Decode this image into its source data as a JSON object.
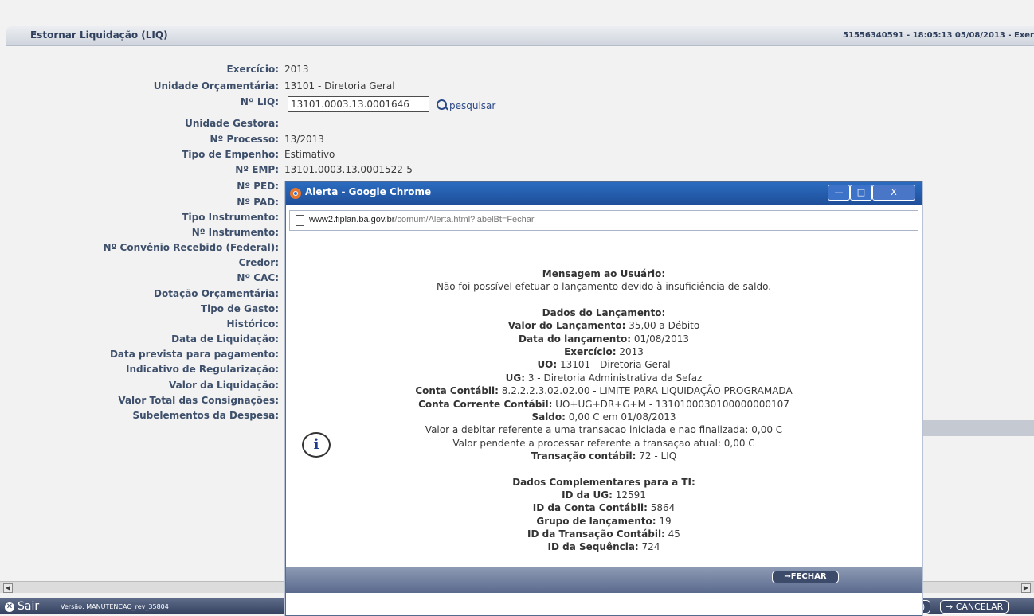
{
  "header": {
    "title": "Estornar Liquidação (LIQ)",
    "session": "51556340591 - 18:05:13 05/08/2013 - Exer"
  },
  "form": {
    "fields": [
      {
        "label": "Exercício:",
        "value": "2013"
      },
      {
        "label": "Unidade Orçamentária:",
        "value": "13101 - Diretoria Geral"
      },
      {
        "label": "Nº LIQ:",
        "value": ""
      },
      {
        "label": "Unidade Gestora:",
        "value": ""
      },
      {
        "label": "Nº Processo:",
        "value": "13/2013"
      },
      {
        "label": "Tipo de Empenho:",
        "value": "Estimativo"
      },
      {
        "label": "Nº EMP:",
        "value": "13101.0003.13.0001522-5"
      },
      {
        "label": "Nº PED:",
        "value": ""
      },
      {
        "label": "Nº PAD:",
        "value": ""
      },
      {
        "label": "Tipo Instrumento:",
        "value": ""
      },
      {
        "label": "Nº Instrumento:",
        "value": ""
      },
      {
        "label": "Nº Convênio Recebido (Federal):",
        "value": ""
      },
      {
        "label": "Credor:",
        "value": ""
      },
      {
        "label": "Nº CAC:",
        "value": ""
      },
      {
        "label": "Dotação Orçamentária:",
        "value": ""
      },
      {
        "label": "Tipo de Gasto:",
        "value": ""
      },
      {
        "label": "Histórico:",
        "value": ""
      },
      {
        "label": "Data de Liquidação:",
        "value": ""
      },
      {
        "label": "Data prevista para pagamento:",
        "value": ""
      },
      {
        "label": "Indicativo de Regularização:",
        "value": ""
      },
      {
        "label": "Valor da Liquidação:",
        "value": ""
      },
      {
        "label": "Valor Total das Consignações:",
        "value": ""
      },
      {
        "label": "Subelementos da Despesa:",
        "value": ""
      }
    ],
    "liq_input_value": "13101.0003.13.0001646",
    "search_label": "pesquisar"
  },
  "footer": {
    "exit_label": "Sair",
    "version": "Versão: MANUTENCAO_rev_35804",
    "cancel_label": "→ CANCELAR",
    "partial_btn_label": ")"
  },
  "dialog": {
    "window_title": "Alerta - Google Chrome",
    "url_host": "www2.fiplan.ba.gov.br",
    "url_path": "/comum/Alerta.html?labelBt=Fechar",
    "lines": [
      {
        "bold": "Mensagem ao Usuário:",
        "text": ""
      },
      {
        "bold": "",
        "text": "Não foi possível efetuar o lançamento devido à insuficiência de saldo."
      },
      {
        "bold": "",
        "text": ""
      },
      {
        "bold": "Dados do Lançamento:",
        "text": ""
      },
      {
        "bold": "Valor do Lançamento:",
        "text": " 35,00 a Débito"
      },
      {
        "bold": "Data do lançamento:",
        "text": " 01/08/2013"
      },
      {
        "bold": "Exercício:",
        "text": " 2013"
      },
      {
        "bold": "UO:",
        "text": " 13101 - Diretoria Geral"
      },
      {
        "bold": "UG:",
        "text": " 3 - Diretoria Administrativa da Sefaz"
      },
      {
        "bold": "Conta Contábil:",
        "text": " 8.2.2.2.3.02.02.00 - LIMITE PARA LIQUIDAÇÃO PROGRAMADA"
      },
      {
        "bold": "Conta Corrente Contábil:",
        "text": " UO+UG+DR+G+M - 1310100030100000000107"
      },
      {
        "bold": "Saldo:",
        "text": " 0,00 C em 01/08/2013"
      },
      {
        "bold": "",
        "text": "Valor a debitar referente a uma transacao iniciada e nao finalizada: 0,00 C"
      },
      {
        "bold": "",
        "text": "Valor pendente a processar referente a transaçao atual: 0,00 C"
      },
      {
        "bold": "Transação contábil:",
        "text": " 72 - LIQ"
      },
      {
        "bold": "",
        "text": ""
      },
      {
        "bold": "Dados Complementares para a TI:",
        "text": ""
      },
      {
        "bold": "ID da UG:",
        "text": " 12591"
      },
      {
        "bold": "ID da Conta Contábil:",
        "text": " 5864"
      },
      {
        "bold": "Grupo de lançamento:",
        "text": " 19"
      },
      {
        "bold": "ID da Transação Contábil:",
        "text": " 45"
      },
      {
        "bold": "ID da Sequência:",
        "text": " 724"
      }
    ],
    "close_label": "→FECHAR",
    "info_glyph": "i"
  },
  "colors": {
    "label": "#3d4f6a",
    "footer_bg": "#34415e",
    "chrome_title": "#2b6cc0"
  }
}
